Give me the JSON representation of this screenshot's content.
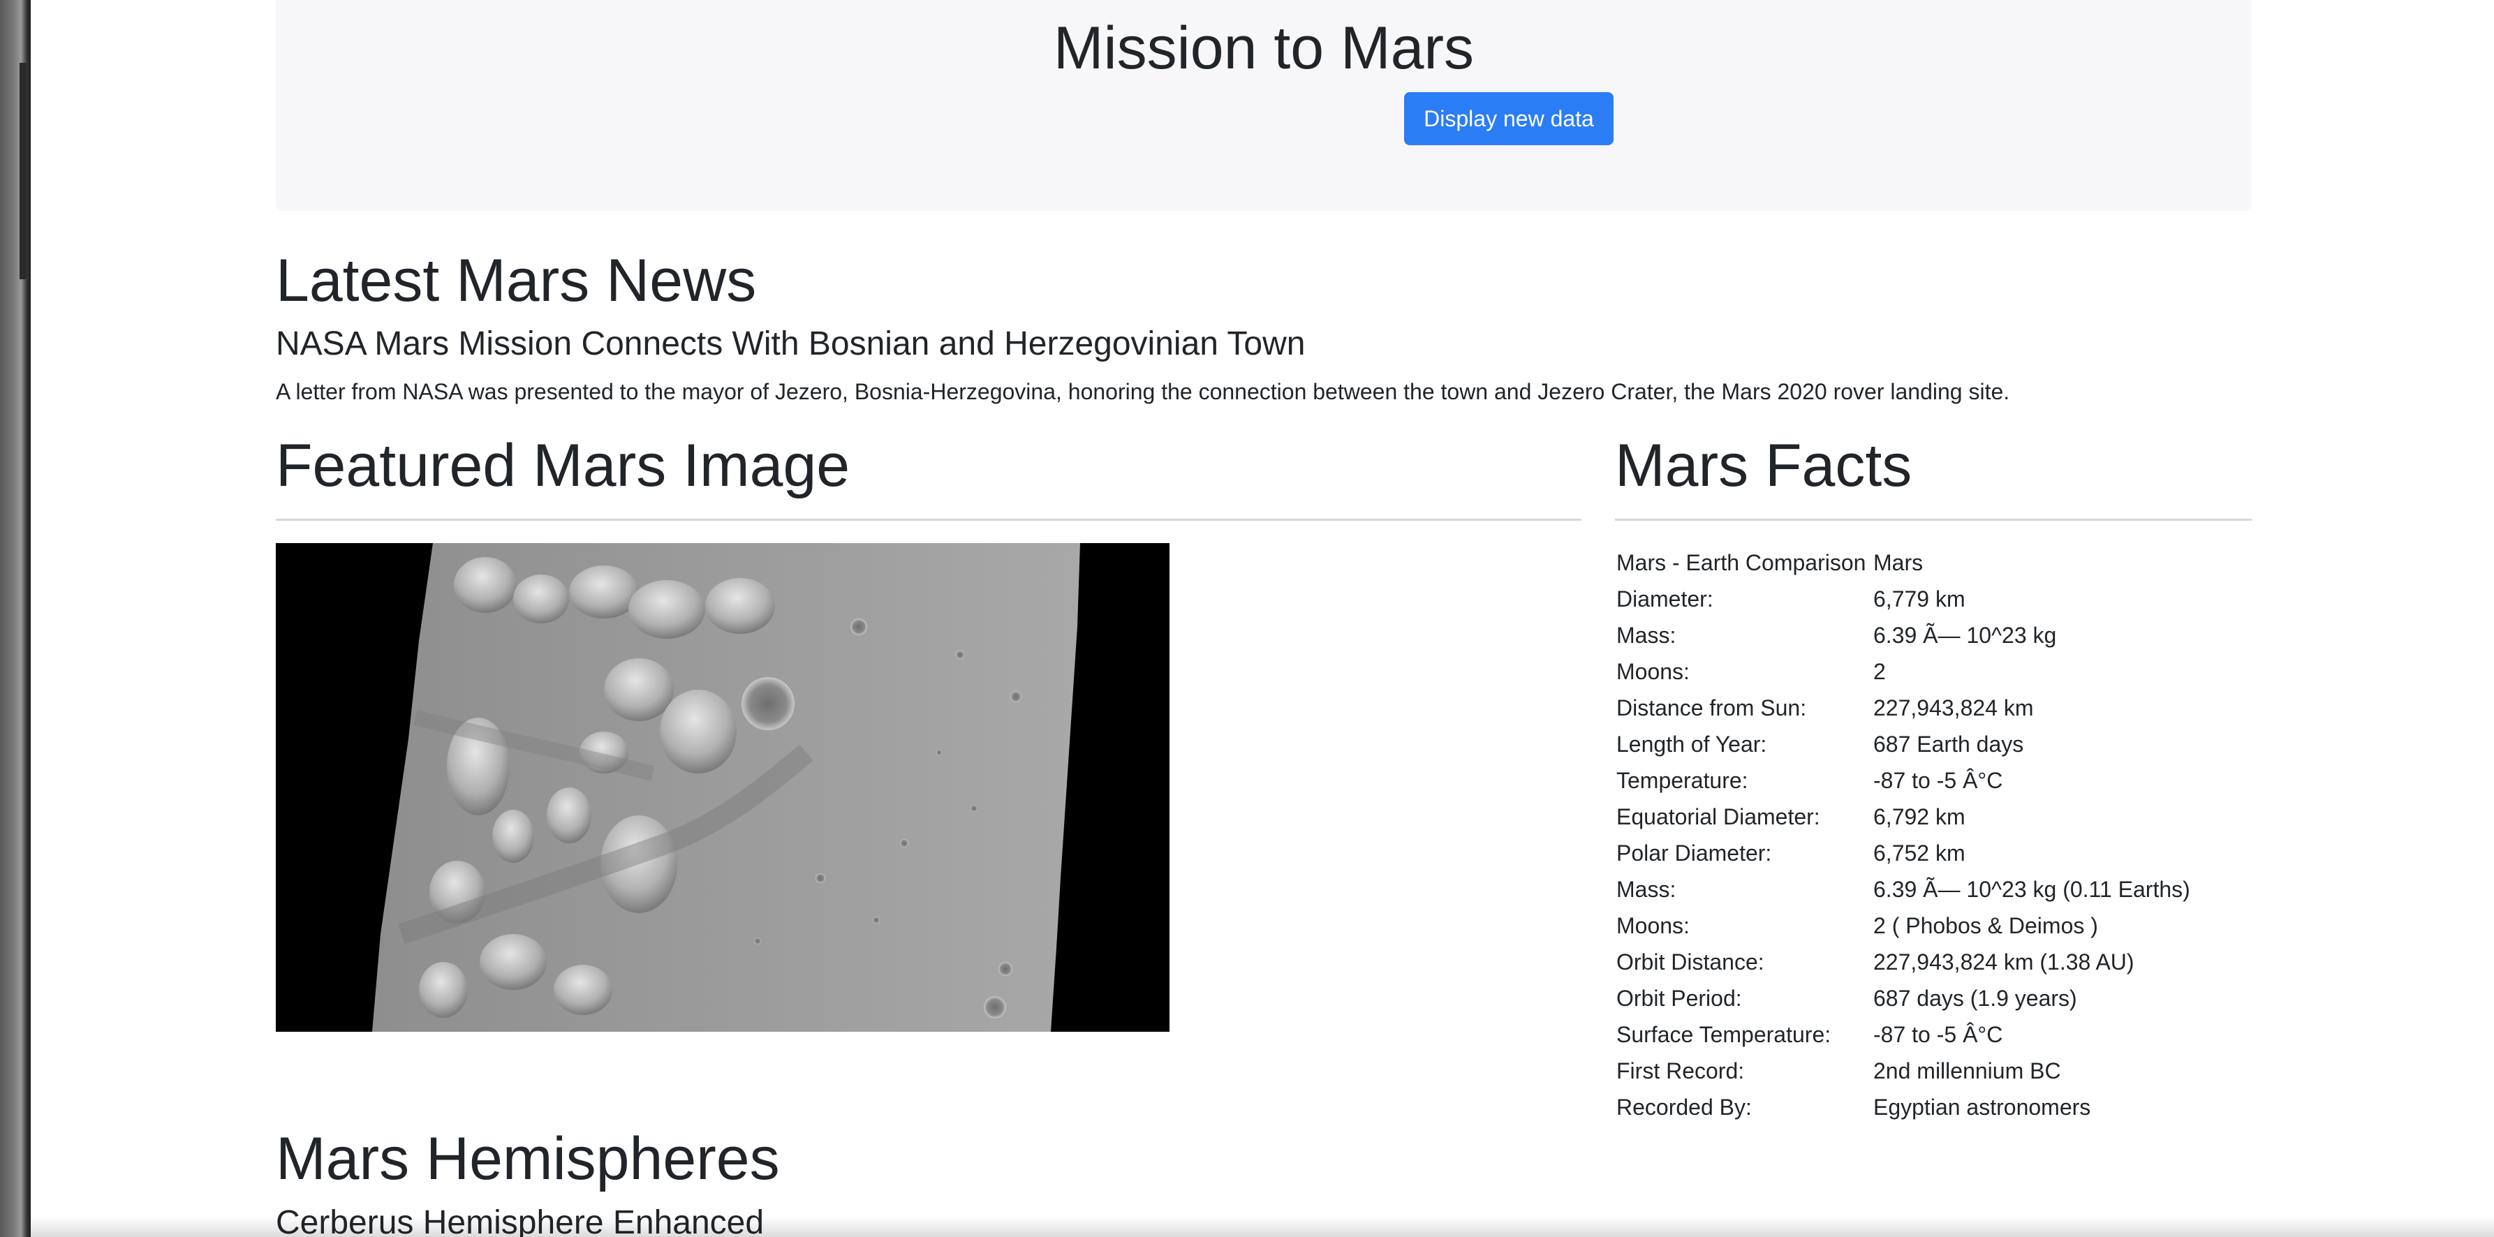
{
  "header": {
    "title": "Mission to Mars",
    "button_label": "Display new data",
    "button_color": "#2b7df6"
  },
  "news": {
    "heading": "Latest Mars News",
    "title": "NASA Mars Mission Connects With Bosnian and Herzegovinian Town",
    "body": "A letter from NASA was presented to the mayor of Jezero, Bosnia-Herzegovina, honoring the connection between the town and Jezero Crater, the Mars 2020 rover landing site."
  },
  "featured_image": {
    "heading": "Featured Mars Image",
    "image_name": "mars-surface-photo"
  },
  "facts": {
    "heading": "Mars Facts",
    "rows": [
      {
        "label": "Mars - Earth Comparison",
        "value": "Mars"
      },
      {
        "label": "Diameter:",
        "value": "6,779 km"
      },
      {
        "label": "Mass:",
        "value": "6.39 Ã— 10^23 kg"
      },
      {
        "label": "Moons:",
        "value": "2"
      },
      {
        "label": "Distance from Sun:",
        "value": "227,943,824 km"
      },
      {
        "label": "Length of Year:",
        "value": "687 Earth days"
      },
      {
        "label": "Temperature:",
        "value": "-87 to -5 Â°C"
      },
      {
        "label": "Equatorial Diameter:",
        "value": "6,792 km"
      },
      {
        "label": "Polar Diameter:",
        "value": "6,752 km"
      },
      {
        "label": "Mass:",
        "value": "6.39 Ã— 10^23 kg (0.11 Earths)"
      },
      {
        "label": "Moons:",
        "value": "2 ( Phobos & Deimos )"
      },
      {
        "label": "Orbit Distance:",
        "value": "227,943,824 km (1.38 AU)"
      },
      {
        "label": "Orbit Period:",
        "value": "687 days (1.9 years)"
      },
      {
        "label": "Surface Temperature:",
        "value": "-87 to -5 Â°C"
      },
      {
        "label": "First Record:",
        "value": "2nd millennium BC"
      },
      {
        "label": "Recorded By:",
        "value": "Egyptian astronomers"
      }
    ]
  },
  "hemispheres": {
    "heading": "Mars Hemispheres",
    "first_title": "Cerberus Hemisphere Enhanced"
  }
}
